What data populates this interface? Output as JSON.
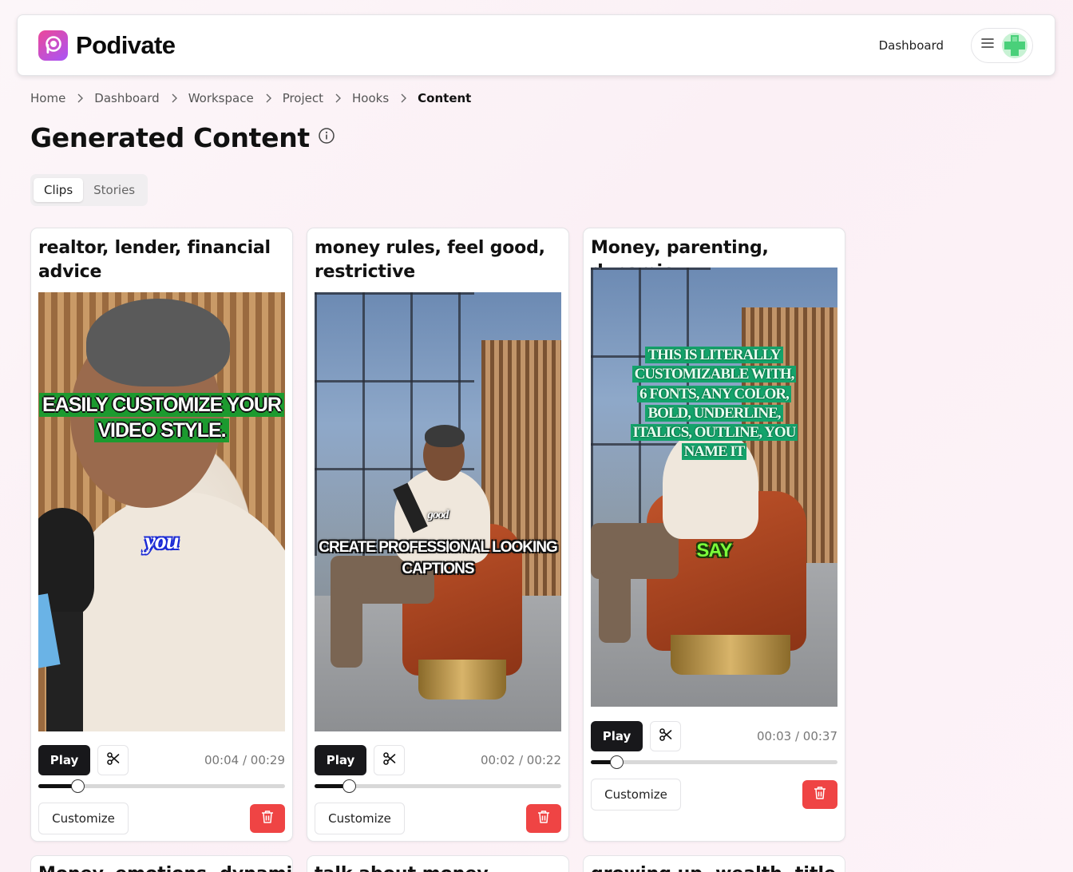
{
  "app": {
    "name": "Podivate"
  },
  "nav": {
    "dashboard_label": "Dashboard"
  },
  "breadcrumb": [
    "Home",
    "Dashboard",
    "Workspace",
    "Project",
    "Hooks",
    "Content"
  ],
  "page": {
    "title": "Generated Content"
  },
  "tabs": [
    {
      "label": "Clips",
      "active": true
    },
    {
      "label": "Stories",
      "active": false
    }
  ],
  "clips": [
    {
      "title": "realtor, lender, financial advice",
      "captions": [
        "EASILY CUSTOMIZE YOUR",
        "VIDEO STYLE.",
        "you"
      ],
      "play_label": "Play",
      "time": "00:04 / 00:29",
      "progress": 0.16,
      "customize_label": "Customize"
    },
    {
      "title": "money rules, feel good, restrictive",
      "captions": [
        "good",
        "CREATE PROFESSIONAL LOOKING",
        "CAPTIONS"
      ],
      "play_label": "Play",
      "time": "00:02 / 00:22",
      "progress": 0.14,
      "customize_label": "Customize"
    },
    {
      "title": "Money, parenting, dynamic",
      "captions": [
        "THIS IS LITERALLY",
        "CUSTOMIZABLE WITH,",
        "6 FONTS, ANY COLOR,",
        "BOLD, UNDERLINE,",
        "ITALICS, OUTLINE, YOU",
        "NAME IT",
        "SAY"
      ],
      "play_label": "Play",
      "time": "00:03 / 00:37",
      "progress": 0.105,
      "customize_label": "Customize"
    }
  ],
  "peek_titles": [
    "Money, emotions, dynamic",
    "talk about money",
    "growing up, wealth, title"
  ],
  "colors": {
    "accent": "#18181b",
    "danger": "#ef4444",
    "logo_start": "#ec4899",
    "logo_end": "#a855f7"
  },
  "icons": [
    "podivate-logo-icon",
    "menu-icon",
    "avatar-icon",
    "chevron-right-icon",
    "info-icon",
    "scissors-icon",
    "trash-icon"
  ]
}
